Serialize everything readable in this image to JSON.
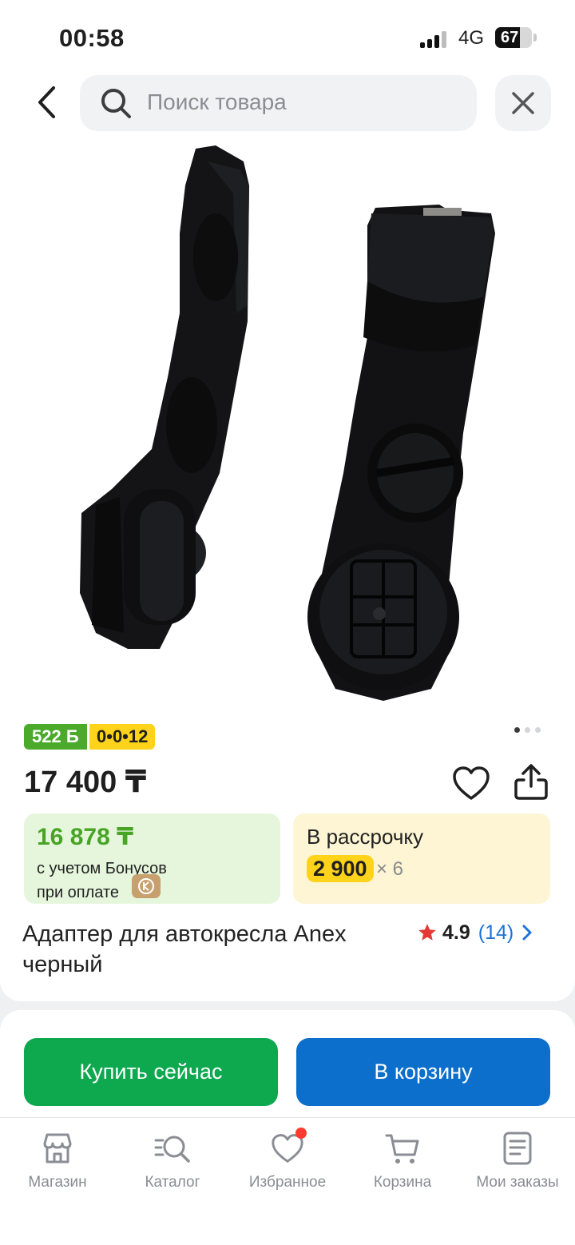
{
  "status_bar": {
    "time": "00:58",
    "network": "4G",
    "battery": "67",
    "battery_level": 0.67
  },
  "search": {
    "placeholder": "Поиск товара"
  },
  "gallery": {
    "image_name": "Адаптер для автокресла Anex черный",
    "current_slide": 1,
    "total_slides": 3
  },
  "badges": {
    "bonus": "522 Б",
    "installment_code": "0•0•12"
  },
  "product": {
    "price": "17 400 ₸",
    "title": "Адаптер для автокресла Anex черный",
    "rating": "4.9",
    "reviews": "(14)"
  },
  "bonus_box": {
    "price": "16 878 ₸",
    "line1": "с учетом Бонусов",
    "line2": "при оплате"
  },
  "installment_box": {
    "title": "В рассрочку",
    "amount": "2 900",
    "multiplier": "× 6"
  },
  "actions": {
    "buy_now": "Купить сейчас",
    "add_to_cart": "В корзину"
  },
  "tabbar": [
    {
      "label": "Магазин",
      "icon": "store-icon"
    },
    {
      "label": "Каталог",
      "icon": "catalog-search-icon"
    },
    {
      "label": "Избранное",
      "icon": "heart-icon"
    },
    {
      "label": "Корзина",
      "icon": "cart-icon"
    },
    {
      "label": "Мои заказы",
      "icon": "orders-icon"
    }
  ],
  "colors": {
    "green": "#0ea84f",
    "blue": "#0c6fcc",
    "bonus_green": "#4caa2b",
    "yellow": "#ffd31a",
    "link": "#1e73d6",
    "star": "#e53935"
  }
}
